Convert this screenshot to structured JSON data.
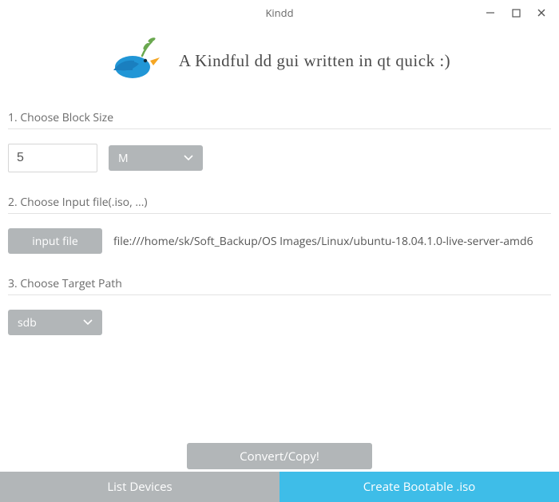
{
  "window": {
    "title": "Kindd"
  },
  "header": {
    "tagline": "A Kindful dd gui written in qt quick :)"
  },
  "colors": {
    "accent": "#3ebde8",
    "muted_button": "#b2b6b8"
  },
  "step1": {
    "label": "1. Choose Block Size",
    "value": "5",
    "unit_selected": "M"
  },
  "step2": {
    "label": "2. Choose Input file(.iso, ...)",
    "button": "input file",
    "path": "file:///home/sk/Soft_Backup/OS Images/Linux/ubuntu-18.04.1.0-live-server-amd6"
  },
  "step3": {
    "label": "3. Choose Target Path",
    "selected": "sdb"
  },
  "actions": {
    "convert": "Convert/Copy!"
  },
  "tabs": {
    "list_devices": "List Devices",
    "create_bootable": "Create Bootable .iso"
  }
}
